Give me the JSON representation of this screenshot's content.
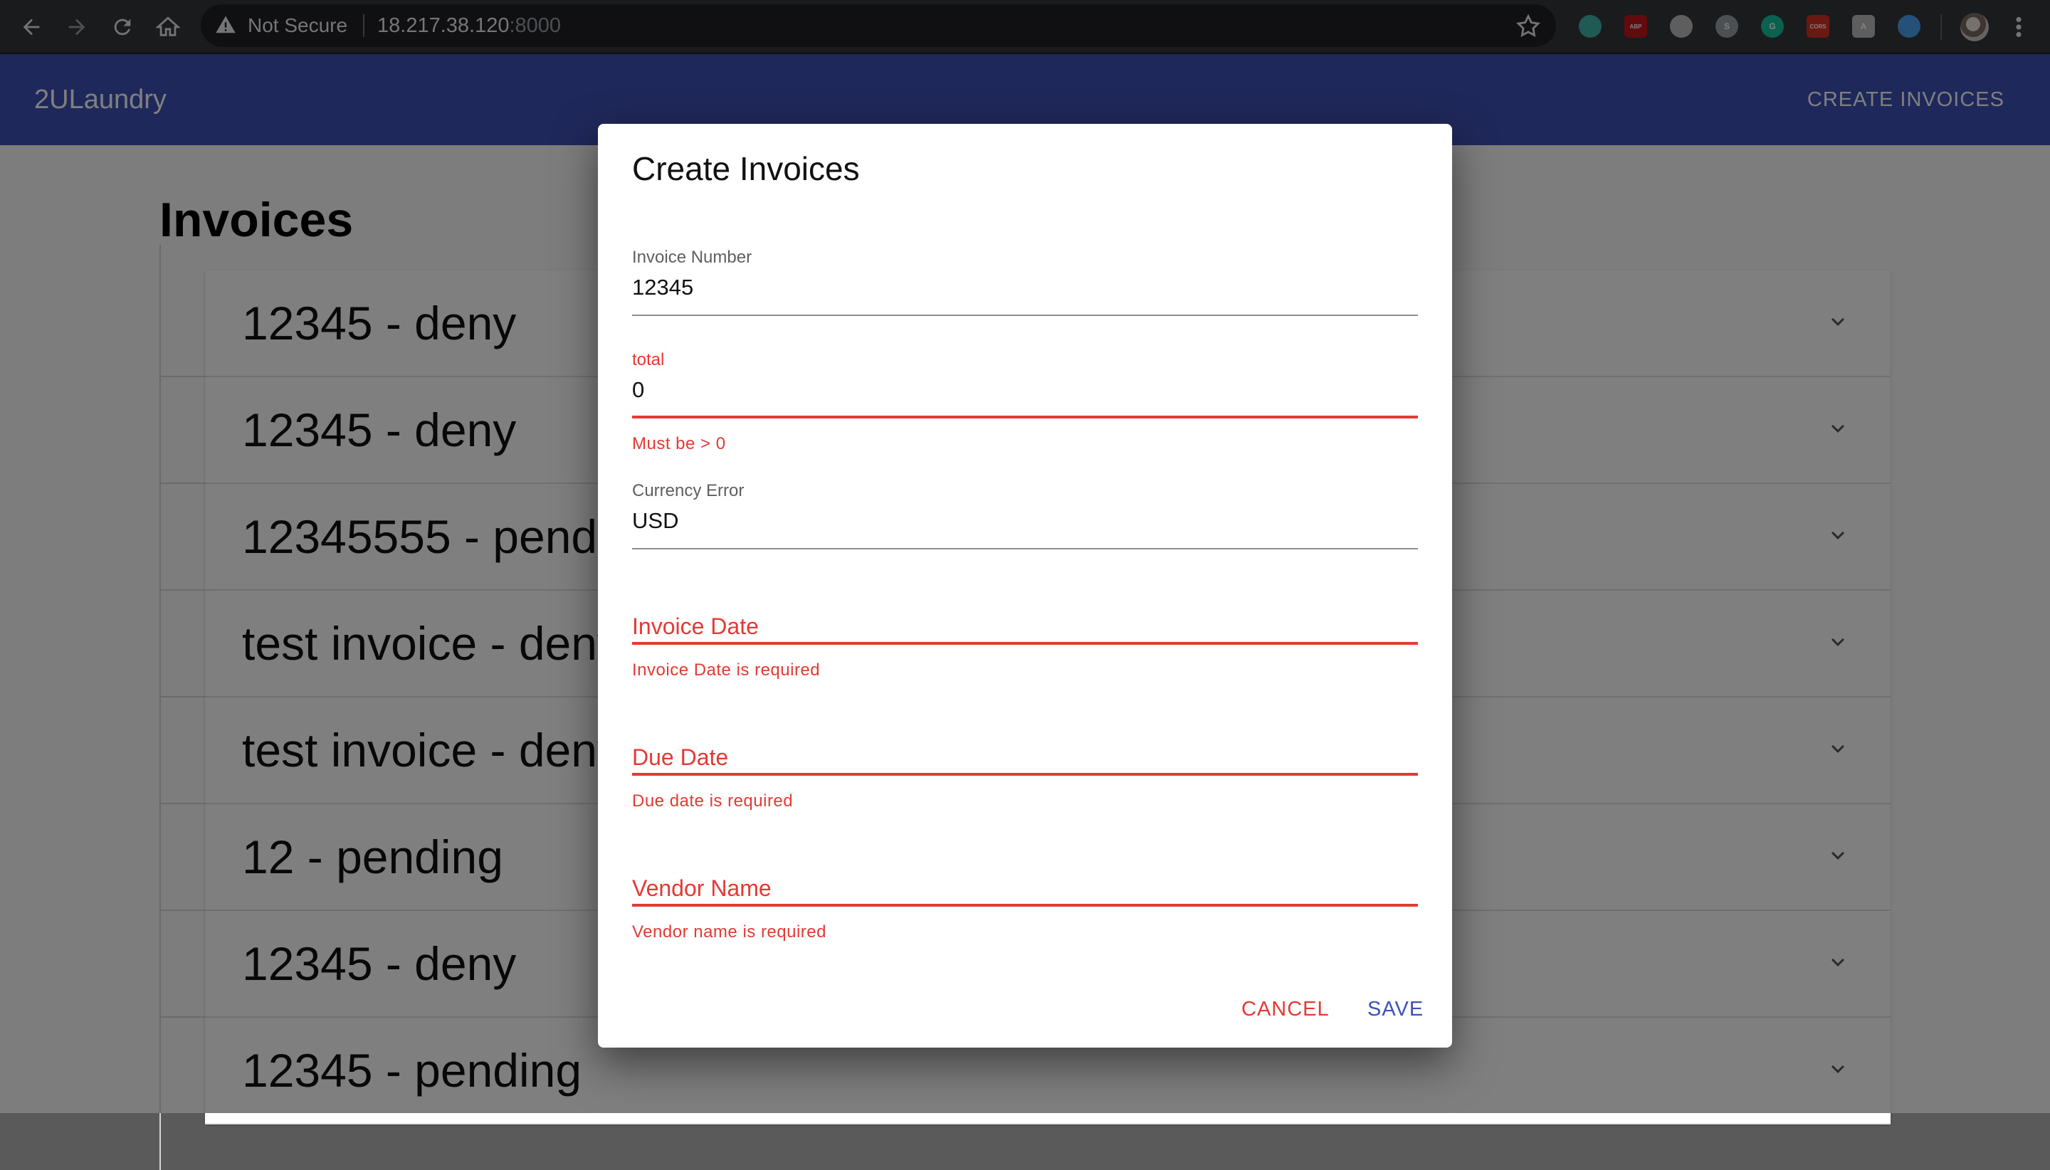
{
  "browser": {
    "security_text": "Not Secure",
    "url_host": "18.217.38.120",
    "url_port": ":8000",
    "extensions": [
      {
        "icon": "extension-green-circle-icon",
        "color": "#3fb5a8",
        "text": ""
      },
      {
        "icon": "adblock-plus-icon",
        "color": "#c4161c",
        "text": "ABP"
      },
      {
        "icon": "extension-white-circle-icon",
        "color": "#bdbdbd",
        "text": ""
      },
      {
        "icon": "skype-icon",
        "color": "#9aa0a6",
        "text": "S"
      },
      {
        "icon": "grammarly-icon",
        "color": "#15c39a",
        "text": "G"
      },
      {
        "icon": "cors-icon",
        "color": "#d93025",
        "text": "CORS"
      },
      {
        "icon": "extension-grey-square-icon",
        "color": "#bdbdbd",
        "text": "A"
      },
      {
        "icon": "diamond-icon",
        "color": "#4aa3f0",
        "text": ""
      }
    ]
  },
  "app": {
    "title": "2ULaundry",
    "action": "CREATE INVOICES",
    "brand_color": "#3f51b5"
  },
  "page": {
    "title": "Invoices",
    "invoices": [
      {
        "label": "12345 - deny"
      },
      {
        "label": "12345 - deny"
      },
      {
        "label": "12345555 - pending"
      },
      {
        "label": "test invoice - deny"
      },
      {
        "label": "test invoice - deny"
      },
      {
        "label": "12 - pending"
      },
      {
        "label": "12345 - deny"
      },
      {
        "label": "12345 - pending"
      }
    ]
  },
  "dialog": {
    "title": "Create Invoices",
    "fields": {
      "invoice_number": {
        "label": "Invoice Number",
        "value": "12345"
      },
      "total": {
        "label": "total",
        "value": "0",
        "error": "Must be > 0"
      },
      "currency": {
        "label": "Currency Error",
        "value": "USD"
      },
      "invoice_date": {
        "placeholder": "Invoice Date",
        "error": "Invoice Date is required"
      },
      "due_date": {
        "placeholder": "Due Date",
        "error": "Due date is required"
      },
      "vendor_name": {
        "placeholder": "Vendor Name",
        "error": "Vendor name is required"
      }
    },
    "cancel_label": "CANCEL",
    "save_label": "SAVE",
    "error_color": "#e53935"
  }
}
